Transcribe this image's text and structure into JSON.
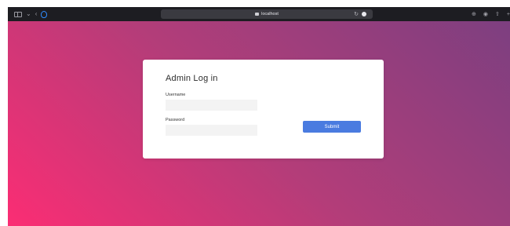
{
  "browser": {
    "url": "localhost",
    "icons": [
      "sidebar-icon",
      "chevron-down-icon",
      "back-icon",
      "shield-icon",
      "reload-icon",
      "download-icon",
      "share-icon",
      "extensions-icon",
      "new-tab-icon"
    ]
  },
  "login": {
    "title": "Admin Log in",
    "username_label": "Username",
    "username_value": "",
    "password_label": "Password",
    "password_value": "",
    "submit_label": "Submit"
  },
  "colors": {
    "gradient_start": "#fb2d74",
    "gradient_mid": "#b33d79",
    "gradient_end": "#7d3f80",
    "submit_button": "#4a7be0",
    "toolbar": "#1d1d22"
  }
}
